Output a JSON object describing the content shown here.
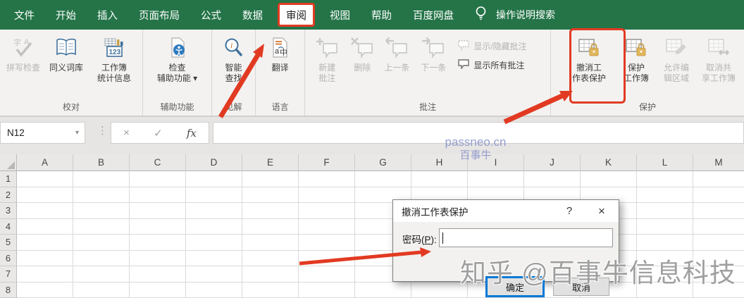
{
  "topbar": {
    "tabs": [
      "文件",
      "开始",
      "插入",
      "页面布局",
      "公式",
      "数据",
      "审阅",
      "视图",
      "帮助",
      "百度网盘"
    ],
    "active_tab": "审阅",
    "search_label": "操作说明搜索"
  },
  "ribbon": {
    "proofing": {
      "group_label": "校对",
      "spell_check": "拼写检查",
      "thesaurus": "同义词库",
      "workbook_stats": "工作簿\n统计信息"
    },
    "accessibility": {
      "group_label": "辅助功能",
      "check_accessibility": "检查\n辅助功能 ▾"
    },
    "insights": {
      "group_label": "见解",
      "smart_lookup": "智能\n查找"
    },
    "language": {
      "group_label": "语言",
      "translate": "翻译"
    },
    "comments": {
      "group_label": "批注",
      "new_comment": "新建\n批注",
      "delete": "删除",
      "previous": "上一条",
      "next": "下一条",
      "show_hide": "显示/隐藏批注",
      "show_all": "显示所有批注"
    },
    "protect": {
      "group_label": "保护",
      "unprotect_sheet": "撤消工\n作表保护",
      "protect_workbook": "保护\n工作簿",
      "allow_edit_ranges": "允许编\n辑区域",
      "unshare_workbook": "取消共\n享工作簿"
    }
  },
  "formula_bar": {
    "name_box": "N12",
    "caret": "▾",
    "dots": "⋮",
    "cancel": "×",
    "enter": "✓",
    "fx": "fx",
    "value": ""
  },
  "sheet": {
    "columns": [
      "A",
      "B",
      "C",
      "D",
      "E",
      "F",
      "G",
      "H",
      "I",
      "J",
      "K",
      "L",
      "M"
    ],
    "rows": [
      "1",
      "2",
      "3",
      "4",
      "5",
      "6",
      "7",
      "8"
    ]
  },
  "dialog": {
    "title": "撤消工作表保护",
    "help": "?",
    "close": "×",
    "password_label_pre": "密码(",
    "password_label_key": "P",
    "password_label_post": "):",
    "password_value": "",
    "ok": "确定",
    "cancel": "取消"
  },
  "watermarks": {
    "site_line1": "passneo.cn",
    "site_line2": "百事牛",
    "credit": "知乎 @百事牛信息科技"
  },
  "colors": {
    "excel_green": "#247448",
    "highlight_red": "#e23a22",
    "focus_blue": "#0078d7",
    "lock_gold": "#e2b65c",
    "watermark_blue": "#8d96cb",
    "watermark_grey": "#8a8a8a"
  }
}
